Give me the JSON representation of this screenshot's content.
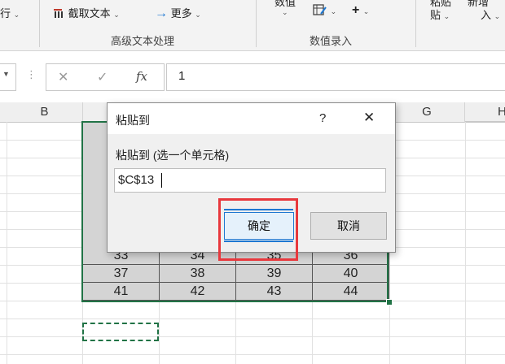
{
  "ribbon": {
    "row_label": "行",
    "extract_text_label": "截取文本",
    "more_label": "更多",
    "group_advanced_text": "高级文本处理",
    "value_top_label": "数值",
    "group_value_entry": "数值录入",
    "paste_label": "贴",
    "insert_label": "入",
    "right_top_label_1": "粘贴",
    "right_top_label_2": "新增",
    "plus_label": "+",
    "chevron": "⌄"
  },
  "formula_bar": {
    "cancel_icon": "✕",
    "enter_icon": "✓",
    "fx_label": "fx",
    "value": "1",
    "dots": "⋮"
  },
  "columns": [
    "B",
    "G",
    "H"
  ],
  "table": {
    "rows": [
      [
        "33",
        "34",
        "35",
        "36"
      ],
      [
        "37",
        "38",
        "39",
        "40"
      ],
      [
        "41",
        "42",
        "43",
        "44"
      ]
    ]
  },
  "dialog": {
    "title": "粘贴到",
    "help": "?",
    "close": "✕",
    "prompt": "粘贴到 (选一个单元格)",
    "input_value": "$C$13",
    "ok_label": "确定",
    "cancel_label": "取消"
  },
  "colors": {
    "selection_border": "#217346",
    "highlight_box": "#e8383d",
    "accent_blue": "#1e78d2"
  }
}
